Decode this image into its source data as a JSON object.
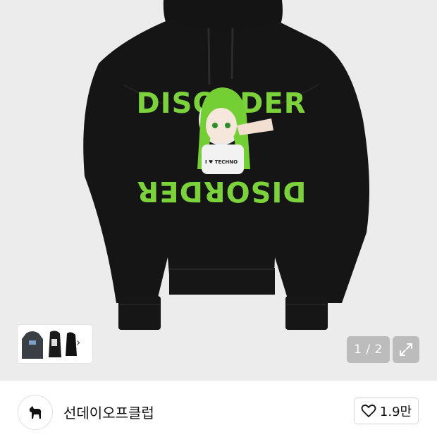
{
  "gallery": {
    "product_print_text": "DISORDER",
    "shirt_text": "I ♥ TECHNO",
    "counter": "1 / 2",
    "colors": {
      "hoodie": "#141414",
      "print_green": "#7bd23a",
      "background": "#ececec"
    }
  },
  "thumbnails": {
    "more_icon": "chevron-right-icon"
  },
  "shop": {
    "name": "선데이오프클럽",
    "logo_icon": "goat-icon",
    "like_count": "1.9만",
    "like_icon": "heart-outline-icon"
  }
}
